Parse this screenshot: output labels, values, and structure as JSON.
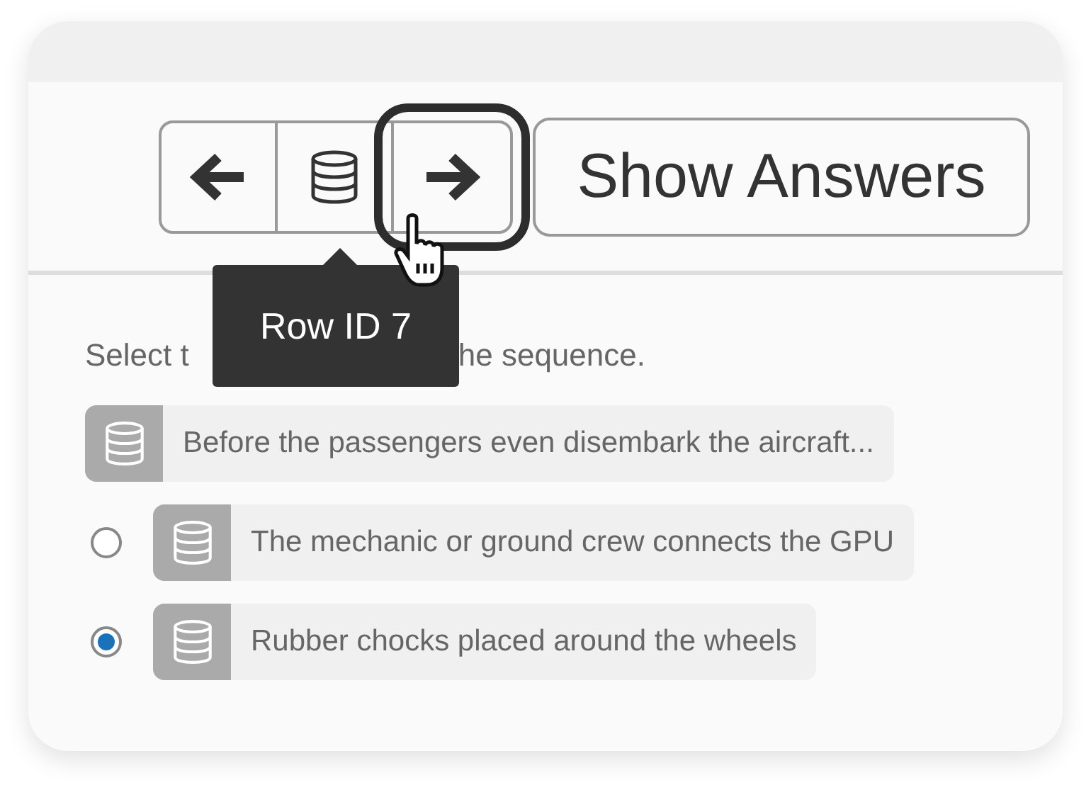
{
  "toolbar": {
    "buttons": [
      {
        "kind": "prev",
        "focused": false
      },
      {
        "kind": "data",
        "focused": false
      },
      {
        "kind": "next",
        "focused": true
      }
    ],
    "show_answers": "Show Answers"
  },
  "tooltip": "Row ID 7",
  "instruction_parts": [
    "Select t",
    "he sequence."
  ],
  "prompt": "Before the passengers even disembark the aircraft...",
  "options": [
    {
      "label": "The mechanic or ground crew connects the GPU",
      "selected": false
    },
    {
      "label": "Rubber chocks placed around the wheels",
      "selected": true
    }
  ]
}
